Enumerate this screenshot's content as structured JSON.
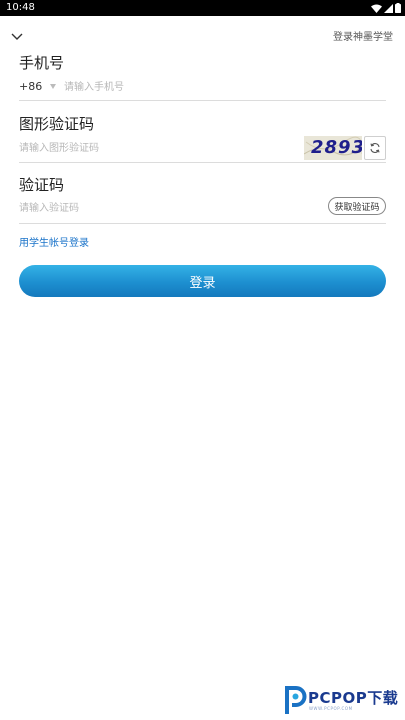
{
  "status_bar": {
    "time": "10:48"
  },
  "header": {
    "link_label": "登录神墨学堂"
  },
  "phone": {
    "title": "手机号",
    "country_code": "+86",
    "placeholder": "请输入手机号",
    "value": ""
  },
  "image_captcha": {
    "title": "图形验证码",
    "placeholder": "请输入图形验证码",
    "value": "",
    "captcha_text": "2893"
  },
  "sms_code": {
    "title": "验证码",
    "placeholder": "请输入验证码",
    "value": "",
    "get_code_label": "获取验证码"
  },
  "student_login_link": "用学生帐号登录",
  "login_button": "登录",
  "watermark": {
    "brand": "PCPOP下载",
    "sub": "WWW.PCPOP.COM"
  },
  "colors": {
    "accent": "#1d8fd0",
    "link": "#1a73c9",
    "captcha_text": "#1f1f8c",
    "captcha_bg": "#e9e6d8"
  }
}
